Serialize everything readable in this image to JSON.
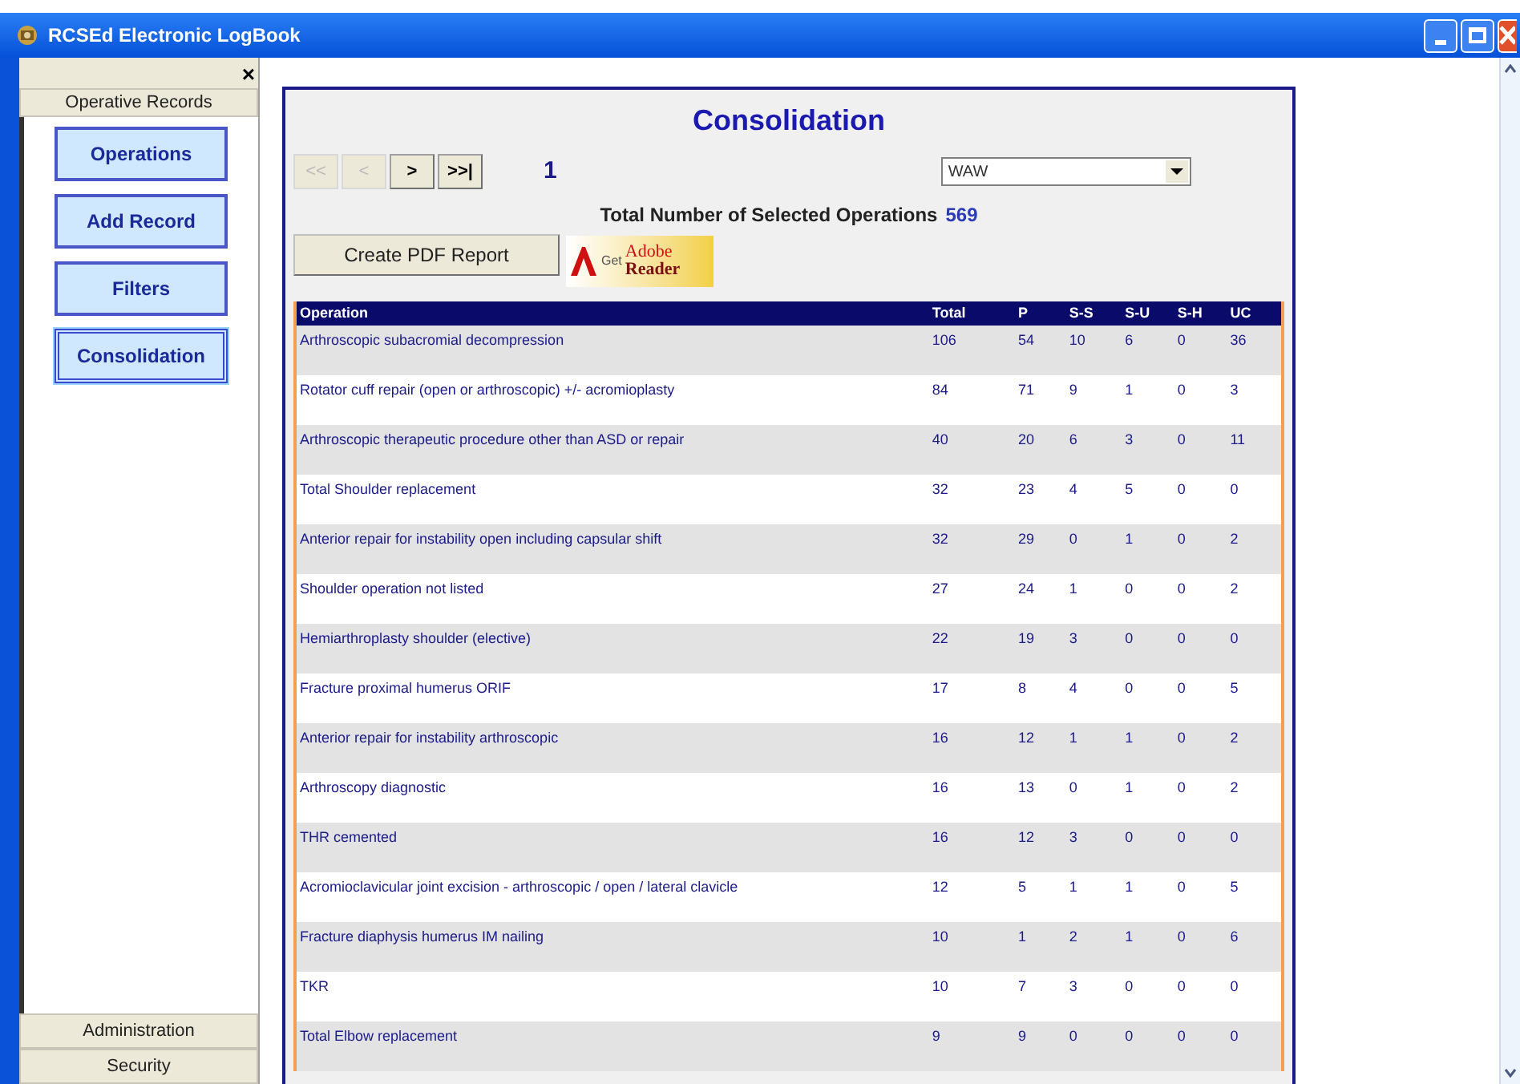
{
  "window": {
    "title": "RCSEd Electronic LogBook"
  },
  "sidebar": {
    "close": "×",
    "section": "Operative Records",
    "items": [
      {
        "label": "Operations",
        "selected": false
      },
      {
        "label": "Add Record",
        "selected": false
      },
      {
        "label": "Filters",
        "selected": false
      },
      {
        "label": "Consolidation",
        "selected": true
      }
    ],
    "bottom_sections": [
      "Administration",
      "Security"
    ]
  },
  "panel": {
    "title": "Consolidation",
    "pager": [
      {
        "label": "<<",
        "disabled": true
      },
      {
        "label": "<",
        "disabled": true
      },
      {
        "label": ">",
        "disabled": false
      },
      {
        "label": ">>|",
        "disabled": false
      }
    ],
    "page": "1",
    "filter": {
      "value": "WAW"
    },
    "total_label": "Total Number of Selected Operations",
    "total_value": "569",
    "pdf_button": "Create PDF Report",
    "reader_badge": {
      "get": "Get",
      "brand": "Adobe",
      "product": "Reader"
    },
    "table": {
      "columns": [
        "Operation",
        "Total",
        "P",
        "S-S",
        "S-U",
        "S-H",
        "UC"
      ],
      "rows": [
        [
          "Arthroscopic subacromial decompression",
          "106",
          "54",
          "10",
          "6",
          "0",
          "36"
        ],
        [
          "Rotator cuff repair (open or arthroscopic) +/- acromioplasty",
          "84",
          "71",
          "9",
          "1",
          "0",
          "3"
        ],
        [
          "Arthroscopic therapeutic procedure other than ASD or repair",
          "40",
          "20",
          "6",
          "3",
          "0",
          "11"
        ],
        [
          "Total Shoulder replacement",
          "32",
          "23",
          "4",
          "5",
          "0",
          "0"
        ],
        [
          "Anterior repair for instability open including capsular shift",
          "32",
          "29",
          "0",
          "1",
          "0",
          "2"
        ],
        [
          "Shoulder operation not listed",
          "27",
          "24",
          "1",
          "0",
          "0",
          "2"
        ],
        [
          "Hemiarthroplasty shoulder (elective)",
          "22",
          "19",
          "3",
          "0",
          "0",
          "0"
        ],
        [
          "Fracture proximal humerus ORIF",
          "17",
          "8",
          "4",
          "0",
          "0",
          "5"
        ],
        [
          "Anterior repair for instability arthroscopic",
          "16",
          "12",
          "1",
          "1",
          "0",
          "2"
        ],
        [
          "Arthroscopy diagnostic",
          "16",
          "13",
          "0",
          "1",
          "0",
          "2"
        ],
        [
          "THR cemented",
          "16",
          "12",
          "3",
          "0",
          "0",
          "0"
        ],
        [
          "Acromioclavicular joint excision - arthroscopic / open / lateral clavicle",
          "12",
          "5",
          "1",
          "1",
          "0",
          "5"
        ],
        [
          "Fracture diaphysis humerus IM nailing",
          "10",
          "1",
          "2",
          "1",
          "0",
          "6"
        ],
        [
          "TKR",
          "10",
          "7",
          "3",
          "0",
          "0",
          "0"
        ],
        [
          "Total Elbow replacement",
          "9",
          "9",
          "0",
          "0",
          "0",
          "0"
        ]
      ]
    }
  }
}
